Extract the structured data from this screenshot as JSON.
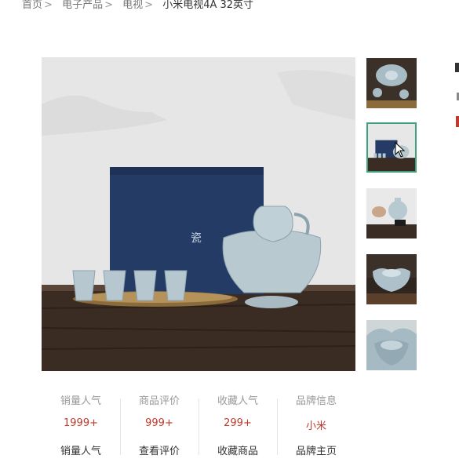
{
  "breadcrumb": {
    "items": [
      "首页",
      "电子产品",
      "电视"
    ],
    "current": "小米电视4A 32英寸",
    "separator": ">"
  },
  "main_image": {
    "alt": ""
  },
  "thumbnails": [
    {
      "active": false
    },
    {
      "active": true
    },
    {
      "active": false
    },
    {
      "active": false
    },
    {
      "active": false
    }
  ],
  "stats": [
    {
      "label": "销量人气",
      "value": "1999+",
      "link": "销量人气"
    },
    {
      "label": "商品评价",
      "value": "999+",
      "link": "查看评价"
    },
    {
      "label": "收藏人气",
      "value": "299+",
      "link": "收藏商品"
    },
    {
      "label": "品牌信息",
      "value": "小米",
      "link": "品牌主页"
    }
  ],
  "colors": {
    "accent_red": "#c0392b",
    "active_thumb_border": "#3fa17c",
    "muted_text": "#999999"
  }
}
